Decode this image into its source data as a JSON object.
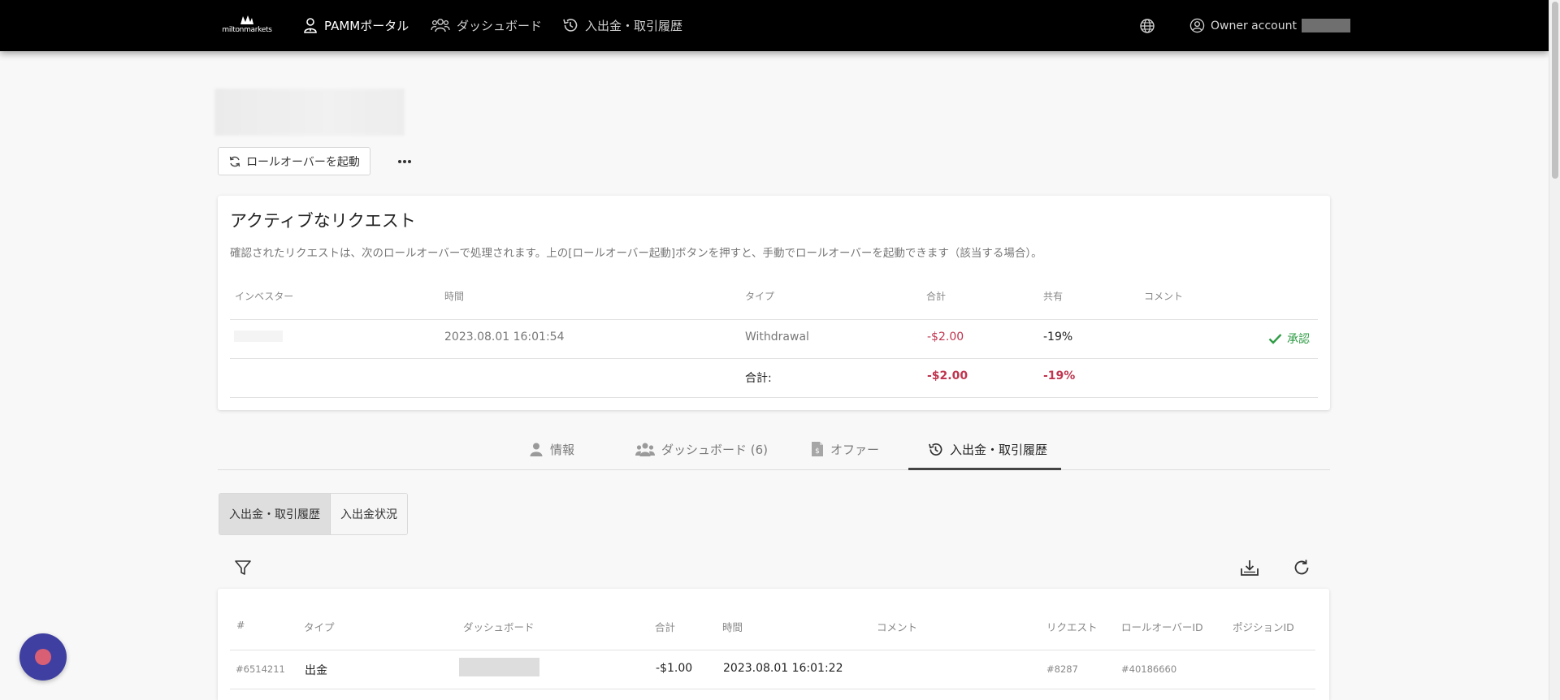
{
  "navbar": {
    "logo_text": "miltonmarkets",
    "items": [
      {
        "label": "PAMMポータル",
        "icon": "user-tie-icon"
      },
      {
        "label": "ダッシュボード",
        "icon": "users-icon"
      },
      {
        "label": "入出金・取引履歴",
        "icon": "history-icon"
      }
    ],
    "language_icon": "globe-icon",
    "account_label": "Owner account"
  },
  "toolbar": {
    "rollover_button": "ロールオーバーを起動",
    "more_icon": "ellipsis-icon"
  },
  "active_requests": {
    "title": "アクティブなリクエスト",
    "description": "確認されたリクエストは、次のロールオーバーで処理されます。上の[ロールオーバー起動]ボタンを押すと、手動でロールオーバーを起動できます（該当する場合）。",
    "columns": [
      "インベスター",
      "時間",
      "タイプ",
      "合計",
      "共有",
      "コメント"
    ],
    "rows": [
      {
        "time": "2023.08.01 16:01:54",
        "type": "Withdrawal",
        "total": "-$2.00",
        "share": "-19%",
        "status": "承認"
      }
    ],
    "summary": {
      "label": "合計:",
      "total": "-$2.00",
      "share": "-19%"
    }
  },
  "tabs": [
    {
      "label": "情報",
      "icon": "user-icon"
    },
    {
      "label": "ダッシュボード (6)",
      "icon": "users-icon"
    },
    {
      "label": "オファー",
      "icon": "document-icon"
    },
    {
      "label": "入出金・取引履歴",
      "icon": "history-icon",
      "active": true
    }
  ],
  "subtabs": [
    {
      "label": "入出金・取引履歴",
      "active": true
    },
    {
      "label": "入出金状況",
      "active": false
    }
  ],
  "history": {
    "columns": [
      "#",
      "タイプ",
      "ダッシュボード",
      "合計",
      "時間",
      "コメント",
      "リクエスト",
      "ロールオーバーID",
      "ポジションID"
    ],
    "rows": [
      {
        "id": "#6514211",
        "type": "出金",
        "total": "-$1.00",
        "time": "2023.08.01 16:01:22",
        "request": "#8287",
        "rollover_id": "#40186660"
      }
    ]
  }
}
